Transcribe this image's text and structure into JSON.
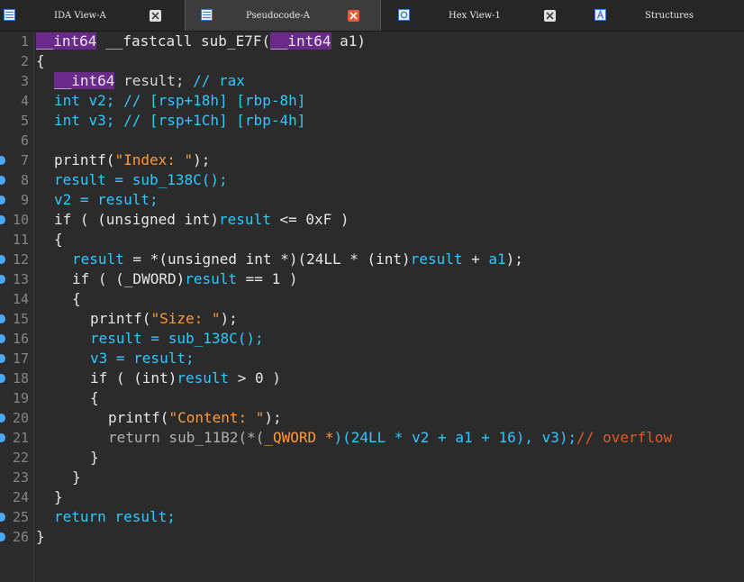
{
  "tabs": [
    {
      "label": "IDA View-A",
      "active": false
    },
    {
      "label": "Pseudocode-A",
      "active": true
    },
    {
      "label": "Hex View-1",
      "active": false
    },
    {
      "label": "Structures",
      "active": false
    }
  ],
  "code": {
    "l1": {
      "num": "1",
      "a": "__int64",
      "b": " __fastcall sub_E7F(",
      "c": "__int64",
      "d": " a1)"
    },
    "l2": {
      "num": "2",
      "a": "{"
    },
    "l3": {
      "num": "3",
      "a": "__int64",
      "b": " result; ",
      "c": "// rax"
    },
    "l4": {
      "num": "4",
      "a": "int v2; ",
      "b": "// [rsp+18h] [rbp-8h]"
    },
    "l5": {
      "num": "5",
      "a": "int v3; ",
      "b": "// [rsp+1Ch] [rbp-4h]"
    },
    "l6": {
      "num": "6"
    },
    "l7": {
      "num": "7",
      "a": "printf(",
      "b": "\"Index: \"",
      "c": ");"
    },
    "l8": {
      "num": "8",
      "a": "result = sub_138C();"
    },
    "l9": {
      "num": "9",
      "a": "v2 = result;"
    },
    "l10": {
      "num": "10",
      "a": "if ( (unsigned int)",
      "b": "result",
      "c": " <= 0xF )"
    },
    "l11": {
      "num": "11",
      "a": "{"
    },
    "l12": {
      "num": "12",
      "a": "result",
      "b": " = *(unsigned int *)(24LL * (int)",
      "c": "result",
      "d": " + ",
      "e": "a1",
      "f": ");"
    },
    "l13": {
      "num": "13",
      "a": "if ( (_DWORD)",
      "b": "result",
      "c": " == 1 )"
    },
    "l14": {
      "num": "14",
      "a": "{"
    },
    "l15": {
      "num": "15",
      "a": "printf(",
      "b": "\"Size: \"",
      "c": ");"
    },
    "l16": {
      "num": "16",
      "a": "result = sub_138C();"
    },
    "l17": {
      "num": "17",
      "a": "v3 = result;"
    },
    "l18": {
      "num": "18",
      "a": "if ( (int)",
      "b": "result",
      "c": " > 0 )"
    },
    "l19": {
      "num": "19",
      "a": "{"
    },
    "l20": {
      "num": "20",
      "a": "printf(",
      "b": "\"Content: \"",
      "c": ");"
    },
    "l21": {
      "num": "21",
      "a": "return sub_11B2(*(",
      "b": "_QWORD *",
      "c": ")(24LL * v2 + a1 + 16), v3);",
      "d": "// overflow"
    },
    "l22": {
      "num": "22",
      "a": "}"
    },
    "l23": {
      "num": "23",
      "a": "}"
    },
    "l24": {
      "num": "24",
      "a": "}"
    },
    "l25": {
      "num": "25",
      "a": "return result;"
    },
    "l26": {
      "num": "26",
      "a": "}"
    }
  },
  "colors": {
    "keyword": "#2ec8ff",
    "string": "#ff9a3a",
    "comment": "#e05a2a",
    "highlight": "#6a2a8a",
    "breakpoint_dot": "#4aa8ff"
  }
}
